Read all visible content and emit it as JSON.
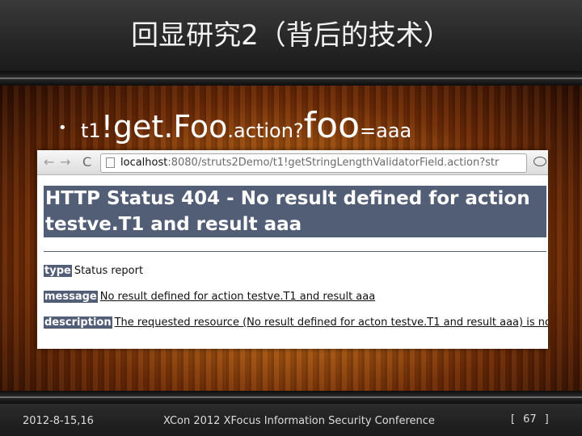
{
  "slide": {
    "title": "回显研究2（背后的技术）",
    "bullet": {
      "part1": "t1",
      "part2": "!get.Foo",
      "part3": ".action?",
      "part4": "foo",
      "part5": "=aaa"
    },
    "footer": {
      "date": "2012-8-15,16",
      "conference": "XCon 2012 XFocus Information Security Conference",
      "page_open": "[",
      "page_number": "67",
      "page_close": "]"
    }
  },
  "browser": {
    "url_host": "localhost",
    "url_rest": ":8080/struts2Demo/t1!getStringLengthValidatorField.action?str",
    "back_icon": "←",
    "forward_icon": "→",
    "reload_icon": "C",
    "star_icon": "☆"
  },
  "error_page": {
    "heading": "HTTP Status 404 - No result defined for action testve.T1 and result aaa",
    "type_label": "type",
    "type_value": "Status report",
    "message_label": "message",
    "message_value": "No result defined for action testve.T1 and result aaa",
    "description_label": "description",
    "description_value": "The requested resource (No result defined for acton testve.T1 and result aaa) is not available"
  },
  "colors": {
    "tomcat_header": "#525d76",
    "title_text": "#f2f2f2",
    "wood_center": "#d9902f"
  }
}
